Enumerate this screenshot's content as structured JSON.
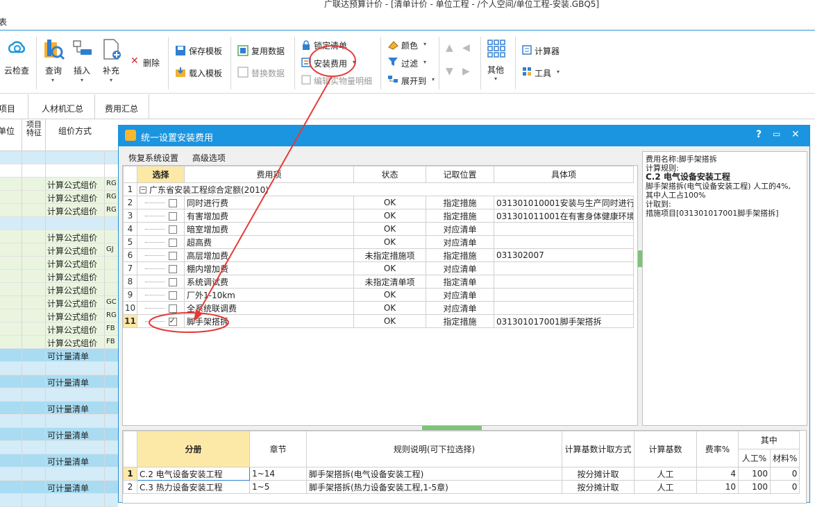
{
  "window": {
    "title": "广联达预算计价 - [清单计价 - 单位工程 - /个人空间/单位工程-安装.GBQ5]",
    "menu_fragment": "表"
  },
  "ribbon": {
    "cloud_check": "云检查",
    "query": "查询",
    "insert": "插入",
    "supplement": "补充",
    "delete": "删除",
    "save_template": "保存模板",
    "load_template": "载入模板",
    "reuse_data": "复用数据",
    "replace_data": "替换数据",
    "lock_list": "锁定清单",
    "install_fee": "安装费用",
    "edit_detail": "编辑实物量明细",
    "color": "颜色",
    "filter": "过滤",
    "expand_to": "展开到",
    "other": "其他",
    "calculator": "计算器",
    "tools": "工具"
  },
  "tabs": [
    "项目",
    "人材机汇总",
    "费用汇总"
  ],
  "bg_grid": {
    "headers": [
      "单位",
      "项目特征",
      "组价方式"
    ],
    "rows": [
      {
        "style": "lb",
        "text": "",
        "code": ""
      },
      {
        "style": "w",
        "text": "",
        "code": ""
      },
      {
        "style": "g",
        "text": "计算公式组价",
        "code": "RG"
      },
      {
        "style": "g",
        "text": "计算公式组价",
        "code": "RG"
      },
      {
        "style": "g",
        "text": "计算公式组价",
        "code": "RG"
      },
      {
        "style": "lb",
        "text": "",
        "code": ""
      },
      {
        "style": "g",
        "text": "计算公式组价",
        "code": ""
      },
      {
        "style": "g",
        "text": "计算公式组价",
        "code": "GJ"
      },
      {
        "style": "g",
        "text": "计算公式组价",
        "code": ""
      },
      {
        "style": "g",
        "text": "计算公式组价",
        "code": ""
      },
      {
        "style": "g",
        "text": "计算公式组价",
        "code": ""
      },
      {
        "style": "g",
        "text": "计算公式组价",
        "code": "GC"
      },
      {
        "style": "g",
        "text": "计算公式组价",
        "code": "RG"
      },
      {
        "style": "g",
        "text": "计算公式组价",
        "code": "FB"
      },
      {
        "style": "g",
        "text": "计算公式组价",
        "code": "FB"
      },
      {
        "style": "b",
        "text": "可计量清单",
        "code": ""
      },
      {
        "style": "lb",
        "text": "",
        "code": ""
      },
      {
        "style": "b",
        "text": "可计量清单",
        "code": ""
      },
      {
        "style": "lb",
        "text": "",
        "code": ""
      },
      {
        "style": "b",
        "text": "可计量清单",
        "code": ""
      },
      {
        "style": "lb",
        "text": "",
        "code": ""
      },
      {
        "style": "b",
        "text": "可计量清单",
        "code": ""
      },
      {
        "style": "lb",
        "text": "",
        "code": ""
      },
      {
        "style": "b",
        "text": "可计量清单",
        "code": ""
      },
      {
        "style": "lb",
        "text": "",
        "code": ""
      },
      {
        "style": "b",
        "text": "可计量清单",
        "code": ""
      },
      {
        "style": "lb",
        "text": "",
        "code": ""
      }
    ]
  },
  "dialog": {
    "title": "统一设置安装费用",
    "menu": [
      "恢复系统设置",
      "高级选项"
    ],
    "upper_headers": [
      "选择",
      "费用项",
      "状态",
      "记取位置",
      "具体项"
    ],
    "group_row": "广东省安装工程综合定额(2010)",
    "rows": [
      {
        "n": "2",
        "checked": false,
        "name": "同时进行费",
        "status": "OK",
        "pos": "指定措施",
        "item": "031301010001安装与生产同时进行…"
      },
      {
        "n": "3",
        "checked": false,
        "name": "有害增加费",
        "status": "OK",
        "pos": "指定措施",
        "item": "031301011001在有害身体健康环境…"
      },
      {
        "n": "4",
        "checked": false,
        "name": "暗室增加费",
        "status": "OK",
        "pos": "对应清单",
        "item": ""
      },
      {
        "n": "5",
        "checked": false,
        "name": "超高费",
        "status": "OK",
        "pos": "对应清单",
        "item": ""
      },
      {
        "n": "6",
        "checked": false,
        "name": "高层增加费",
        "status": "未指定措施项",
        "pos": "指定措施",
        "item": "031302007"
      },
      {
        "n": "7",
        "checked": false,
        "name": "棚内增加费",
        "status": "OK",
        "pos": "对应清单",
        "item": ""
      },
      {
        "n": "8",
        "checked": false,
        "name": "系统调试费",
        "status": "未指定清单项",
        "pos": "指定清单",
        "item": ""
      },
      {
        "n": "9",
        "checked": false,
        "name": "厂外1-10km",
        "status": "OK",
        "pos": "对应清单",
        "item": ""
      },
      {
        "n": "10",
        "checked": false,
        "name": "全系统联调费",
        "status": "OK",
        "pos": "对应清单",
        "item": ""
      },
      {
        "n": "11",
        "checked": true,
        "name": "脚手架搭拆",
        "status": "OK",
        "pos": "指定措施",
        "item": "031301017001脚手架搭拆"
      }
    ],
    "info": {
      "line1": "费用名称:脚手架搭拆",
      "line2": "计算规则:",
      "line3": "C.2 电气设备安装工程",
      "line4": "脚手架搭拆(电气设备安装工程) 人工的4%,",
      "line5": "其中人工占100%",
      "line6": "计取到:",
      "line7": "措施项目[031301017001脚手架搭拆]"
    },
    "lower_headers": [
      "分册",
      "章节",
      "规则说明(可下拉选择)",
      "计算基数计取方式",
      "计算基数",
      "费率%",
      "其中",
      "人工%",
      "材料%"
    ],
    "lower_rows": [
      {
        "n": "1",
        "book": "C.2 电气设备安装工程",
        "chapter": "1~14",
        "rule": "脚手架搭拆(电气设备安装工程)",
        "mode": "按分摊计取",
        "base": "人工",
        "rate": "4",
        "labor": "100",
        "mat": "0"
      },
      {
        "n": "2",
        "book": "C.3 热力设备安装工程",
        "chapter": "1~5",
        "rule": "脚手架搭拆(热力设备安装工程,1-5章)",
        "mode": "按分摊计取",
        "base": "人工",
        "rate": "10",
        "labor": "100",
        "mat": "0"
      }
    ]
  },
  "colors": {
    "accent": "#1b95e0",
    "selected": "#fde9a7",
    "annotation": "#e53935"
  }
}
